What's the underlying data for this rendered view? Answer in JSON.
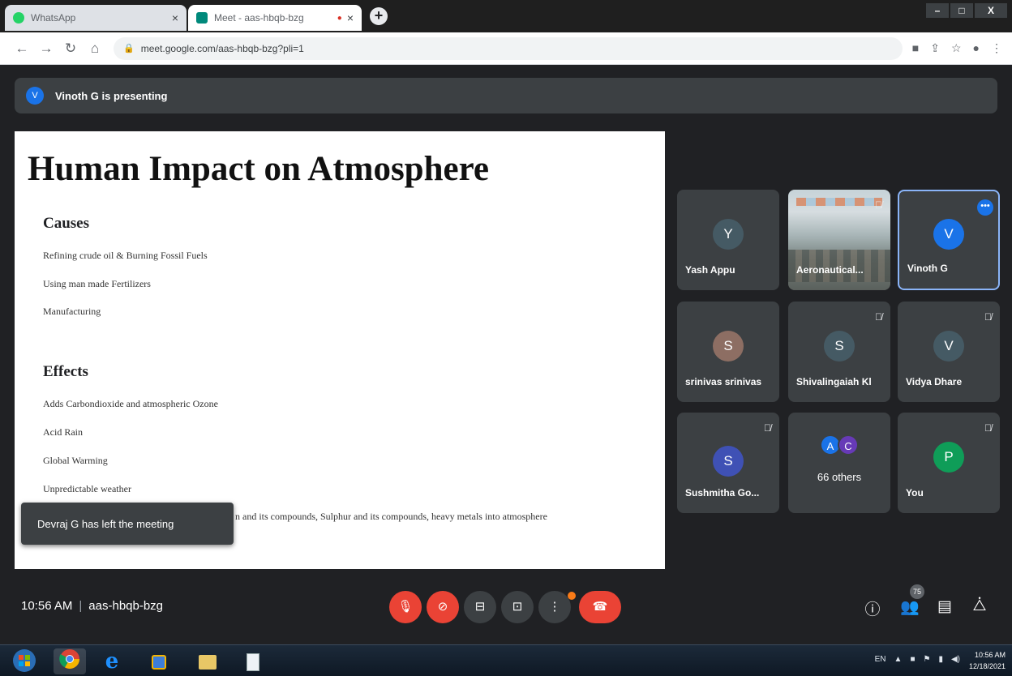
{
  "browser": {
    "tabs": [
      {
        "title": "WhatsApp",
        "close": "×"
      },
      {
        "title": "Meet - aas-hbqb-bzg",
        "close": "×"
      }
    ],
    "new_tab": "+",
    "window_controls": [
      "–",
      "□",
      "X"
    ],
    "url": "meet.google.com/aas-hbqb-bzg?pli=1"
  },
  "meet": {
    "presenter_initial": "V",
    "presenting_text": "Vinoth G is presenting",
    "toast": "Devraj G has left the meeting",
    "time": "10:56 AM",
    "separator": "|",
    "meeting_code": "aas-hbqb-bzg",
    "participant_count": "75"
  },
  "slide": {
    "title": "Human Impact on Atmosphere",
    "causes_heading": "Causes",
    "causes": [
      "Refining crude oil & Burning Fossil Fuels",
      "Using man made Fertilizers",
      "Manufacturing"
    ],
    "effects_heading": "Effects",
    "effects": [
      "Adds Carbondioxide and atmospheric Ozone",
      "Acid Rain",
      "Global Warming",
      "Unpredictable weather"
    ],
    "cut_line": "n and its compounds, Sulphur and its compounds, heavy metals into atmosphere"
  },
  "participants": [
    {
      "name": "Yash Appu",
      "initial": "Y",
      "color": "#455a64"
    },
    {
      "name": "Aeronautical...",
      "initial": ""
    },
    {
      "name": "Vinoth G",
      "initial": "V",
      "color": "#1a73e8"
    },
    {
      "name": "srinivas srinivas",
      "initial": "S",
      "color": "#8d6e63"
    },
    {
      "name": "Shivalingaiah Kl",
      "initial": "S",
      "color": "#455a64"
    },
    {
      "name": "Vidya Dhare",
      "initial": "V",
      "color": "#455a64"
    },
    {
      "name": "Sushmitha Go...",
      "initial": "S",
      "color": "#3f51b5"
    },
    {
      "name": "66 others",
      "initials": [
        "A",
        "C"
      ],
      "colors": [
        "#1a73e8",
        "#673ab7"
      ]
    },
    {
      "name": "You",
      "initial": "P",
      "color": "#0f9d58"
    }
  ],
  "taskbar": {
    "lang": "EN",
    "clock_time": "10:56 AM",
    "clock_date": "12/18/2021"
  }
}
